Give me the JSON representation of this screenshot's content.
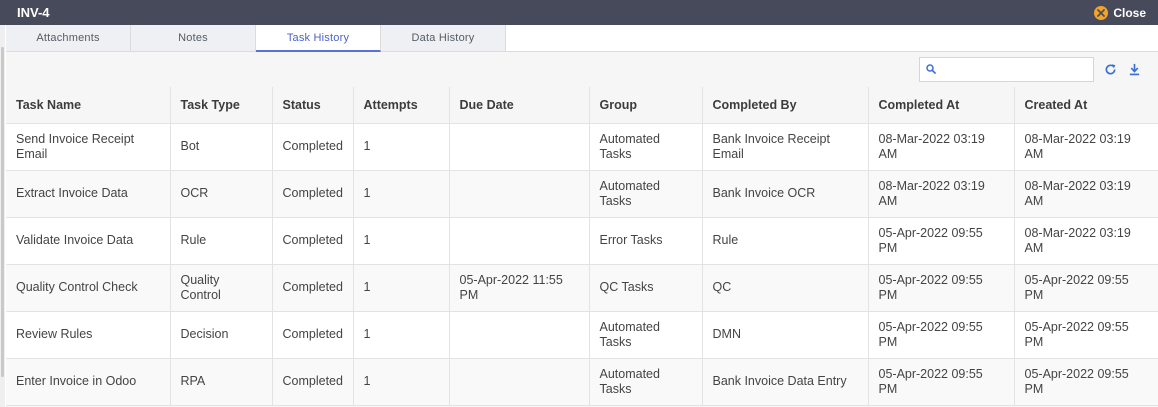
{
  "window": {
    "title": "INV-4",
    "close_label": "Close"
  },
  "tabs": [
    {
      "label": "Attachments",
      "active": false
    },
    {
      "label": "Notes",
      "active": false
    },
    {
      "label": "Task History",
      "active": true
    },
    {
      "label": "Data History",
      "active": false
    }
  ],
  "search": {
    "placeholder": "",
    "value": ""
  },
  "colors": {
    "titlebar": "#474a5a",
    "accent": "#4b63c9",
    "close_icon": "#f3a327"
  },
  "table": {
    "columns": [
      "Task Name",
      "Task Type",
      "Status",
      "Attempts",
      "Due Date",
      "Group",
      "Completed By",
      "Completed At",
      "Created At"
    ],
    "rows": [
      [
        "Send Invoice Receipt Email",
        "Bot",
        "Completed",
        "1",
        "",
        "Automated Tasks",
        "Bank Invoice Receipt Email",
        "08-Mar-2022 03:19 AM",
        "08-Mar-2022 03:19 AM"
      ],
      [
        "Extract Invoice Data",
        "OCR",
        "Completed",
        "1",
        "",
        "Automated Tasks",
        "Bank Invoice OCR",
        "08-Mar-2022 03:19 AM",
        "08-Mar-2022 03:19 AM"
      ],
      [
        "Validate Invoice Data",
        "Rule",
        "Completed",
        "1",
        "",
        "Error Tasks",
        "Rule",
        "05-Apr-2022 09:55 PM",
        "08-Mar-2022 03:19 AM"
      ],
      [
        "Quality Control Check",
        "Quality Control",
        "Completed",
        "1",
        "05-Apr-2022 11:55 PM",
        "QC Tasks",
        "QC",
        "05-Apr-2022 09:55 PM",
        "05-Apr-2022 09:55 PM"
      ],
      [
        "Review Rules",
        "Decision",
        "Completed",
        "1",
        "",
        "Automated Tasks",
        "DMN",
        "05-Apr-2022 09:55 PM",
        "05-Apr-2022 09:55 PM"
      ],
      [
        "Enter Invoice in Odoo",
        "RPA",
        "Completed",
        "1",
        "",
        "Automated Tasks",
        "Bank Invoice Data Entry",
        "05-Apr-2022 09:55 PM",
        "05-Apr-2022 09:55 PM"
      ]
    ]
  }
}
